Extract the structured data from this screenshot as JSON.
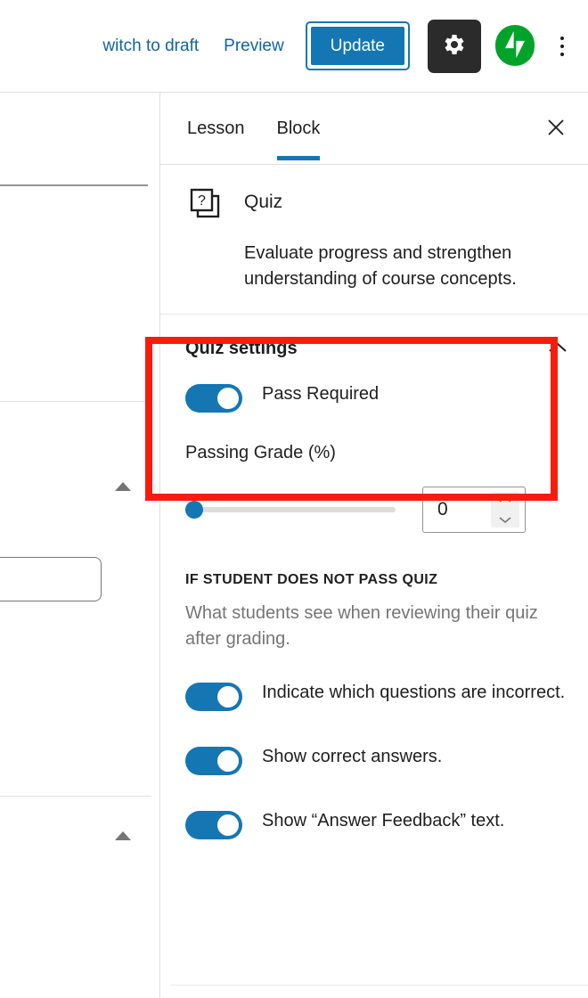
{
  "toolbar": {
    "switch_to_draft_label": "witch to draft",
    "preview_label": "Preview",
    "update_label": "Update",
    "gear_icon": "gear-icon",
    "jetpack_icon": "jetpack-icon",
    "more_icon": "more-vertical-icon"
  },
  "sidebar": {
    "tabs": [
      {
        "label": "Lesson",
        "active": false
      },
      {
        "label": "Block",
        "active": true
      }
    ],
    "close_icon": "close-icon",
    "block": {
      "icon": "quiz-icon",
      "title": "Quiz",
      "description": "Evaluate progress and strengthen understanding of course concepts."
    },
    "quiz_settings": {
      "title": "Quiz settings",
      "collapse_icon": "chevron-up-icon",
      "pass_required": {
        "label": "Pass Required",
        "checked": true
      },
      "passing_grade": {
        "label": "Passing Grade (%)",
        "value": "0",
        "slider_percent": 0,
        "min": "0",
        "max": "100"
      },
      "fail_section": {
        "heading": "IF STUDENT DOES NOT PASS QUIZ",
        "description": "What students see when reviewing their quiz after grading.",
        "options": [
          {
            "label": "Indicate which questions are incorrect.",
            "checked": true
          },
          {
            "label": "Show correct answers.",
            "checked": true
          },
          {
            "label": "Show “Answer Feedback” text.",
            "checked": true
          }
        ]
      }
    }
  },
  "annotation": {
    "highlight_color": "#f91c0a",
    "target": "quiz-settings-pass-required"
  },
  "colors": {
    "accent_blue": "#1477b3",
    "link_blue": "#1164a3",
    "jetpack_green": "#00a32a",
    "text": "#1e1e1e",
    "muted_text": "#757575"
  }
}
